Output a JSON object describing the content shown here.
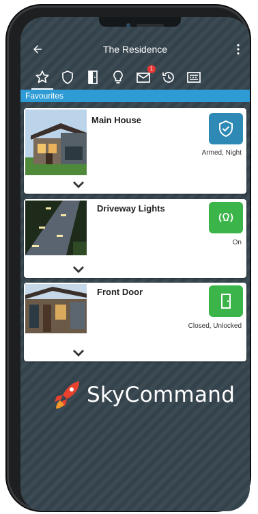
{
  "header": {
    "title": "The Residence"
  },
  "nav_icons": [
    "star-icon",
    "shield-icon",
    "door-icon",
    "bulb-icon",
    "mail-icon",
    "history-icon",
    "keypad-icon"
  ],
  "notifications": {
    "mail_count": "1"
  },
  "section": {
    "title": "Favourites"
  },
  "cards": [
    {
      "name": "Main House",
      "status": "Armed, Night",
      "tile_color": "#2e8ab4",
      "tile_icon": "shield-check-icon"
    },
    {
      "name": "Driveway Lights",
      "status": "On",
      "tile_color": "#3bb44a",
      "tile_icon": "light-on-icon"
    },
    {
      "name": "Front Door",
      "status": "Closed, Unlocked",
      "tile_color": "#3bb44a",
      "tile_icon": "door-open-icon"
    }
  ],
  "brand": {
    "name": "SkyCommand",
    "accent": "#e8412d"
  }
}
